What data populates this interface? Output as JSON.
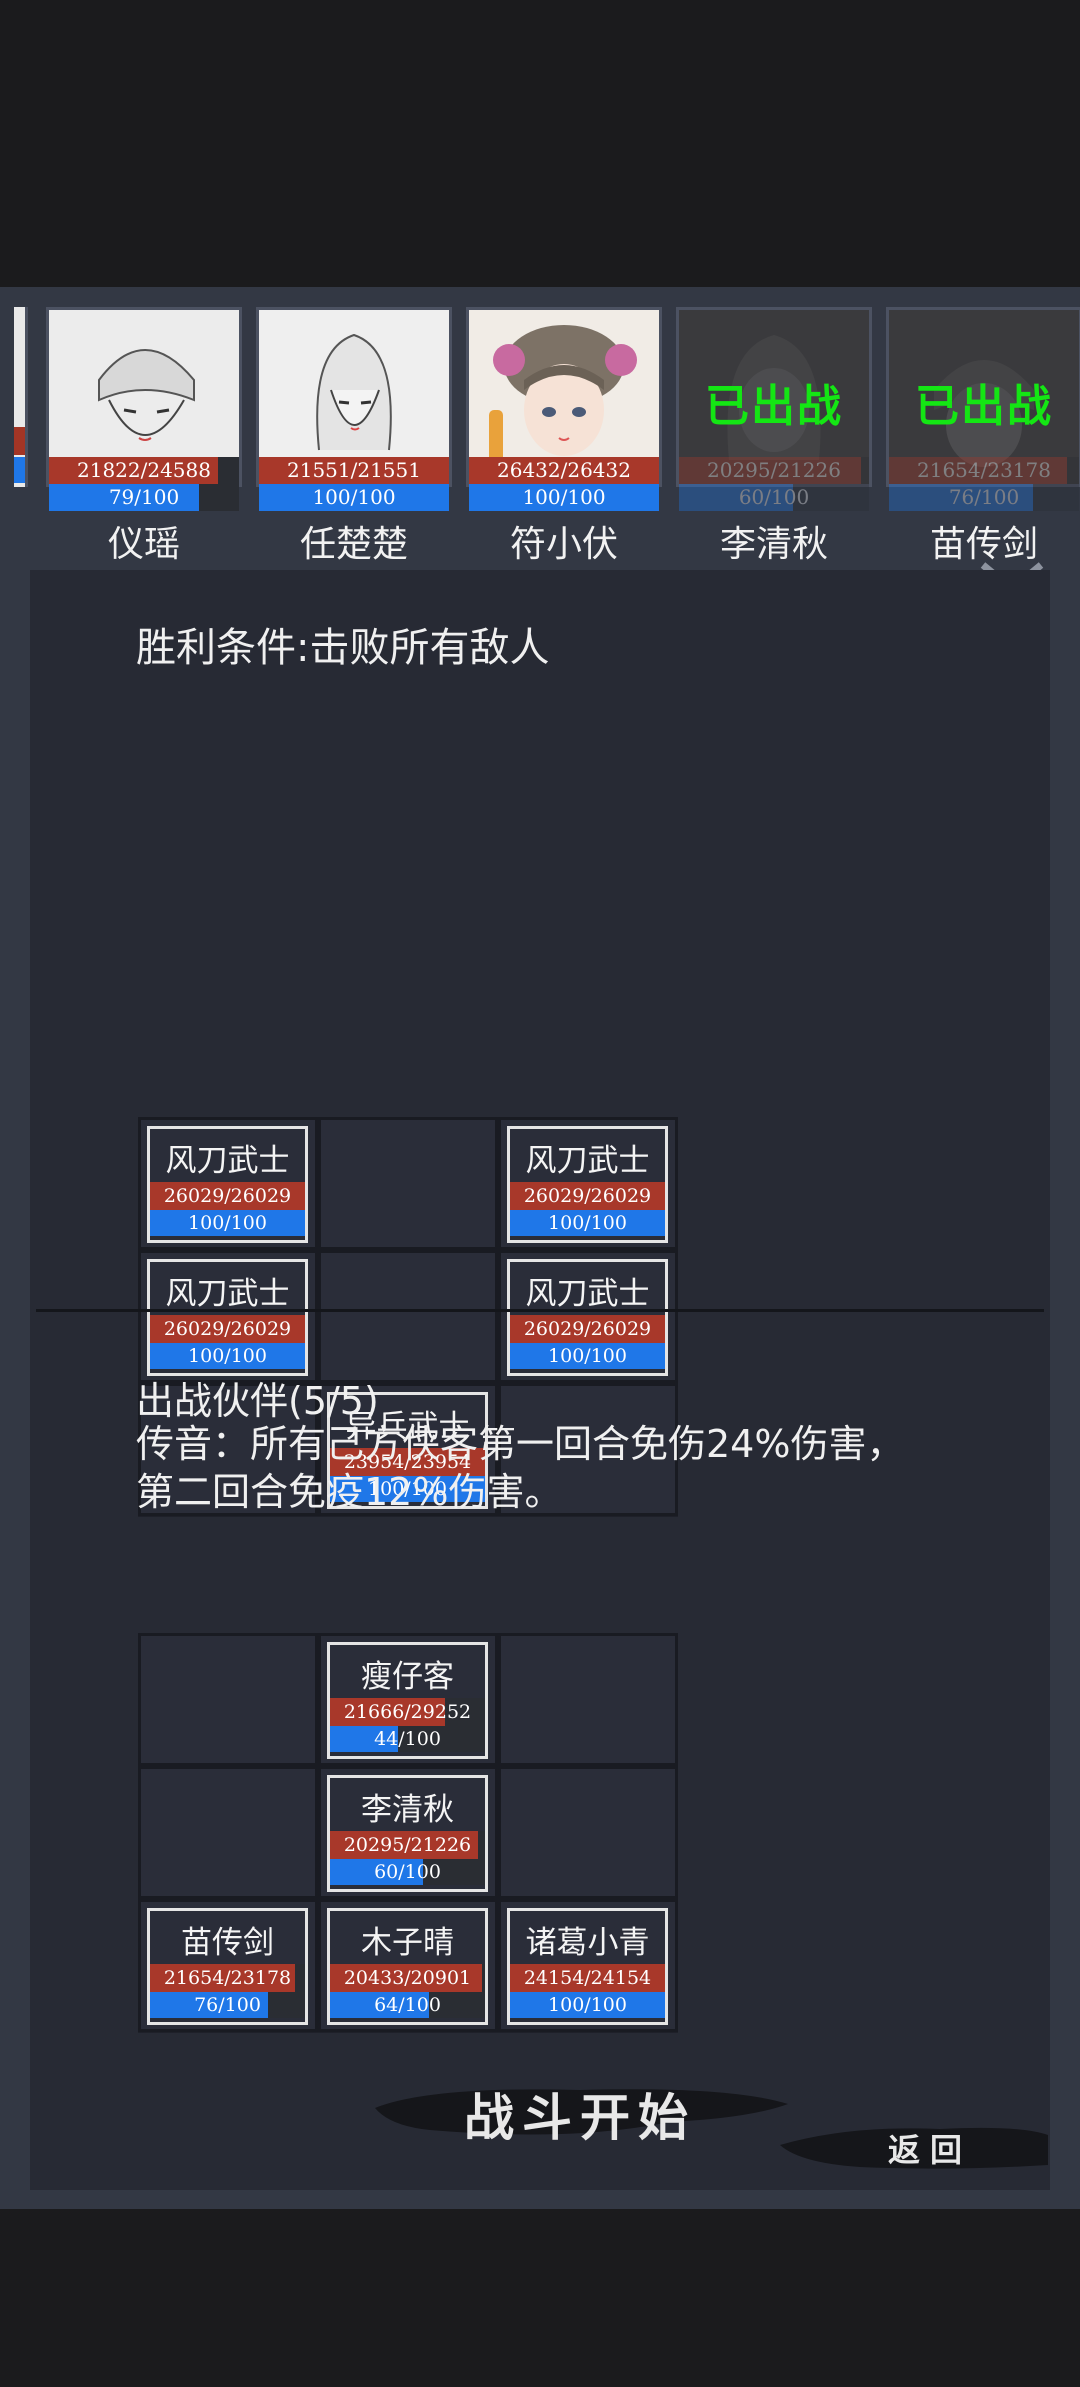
{
  "roster": [
    {
      "name": "仪瑶",
      "hp_text": "21822/24588",
      "hp": 21822,
      "hp_max": 24588,
      "mp_text": "79/100",
      "mp": 79,
      "deployed": false,
      "deployed_label": ""
    },
    {
      "name": "任楚楚",
      "hp_text": "21551/21551",
      "hp": 21551,
      "hp_max": 21551,
      "mp_text": "100/100",
      "mp": 100,
      "deployed": false,
      "deployed_label": ""
    },
    {
      "name": "符小伏",
      "hp_text": "26432/26432",
      "hp": 26432,
      "hp_max": 26432,
      "mp_text": "100/100",
      "mp": 100,
      "deployed": false,
      "deployed_label": ""
    },
    {
      "name": "李清秋",
      "hp_text": "20295/21226",
      "hp": 20295,
      "hp_max": 21226,
      "mp_text": "60/100",
      "mp": 60,
      "deployed": true,
      "deployed_label": "已出战"
    },
    {
      "name": "苗传剑",
      "hp_text": "21654/23178",
      "hp": 21654,
      "hp_max": 23178,
      "mp_text": "76/100",
      "mp": 76,
      "deployed": true,
      "deployed_label": "已出战"
    }
  ],
  "victory_condition": "胜利条件:击败所有敌人",
  "enemies": [
    {
      "name": "风刀武士",
      "hp_text": "26029/26029",
      "hp": 26029,
      "hp_max": 26029,
      "mp_text": "100/100",
      "mp": 100
    },
    {
      "name": "风刀武士",
      "hp_text": "26029/26029",
      "hp": 26029,
      "hp_max": 26029,
      "mp_text": "100/100",
      "mp": 100
    },
    {
      "name": "风刀武士",
      "hp_text": "26029/26029",
      "hp": 26029,
      "hp_max": 26029,
      "mp_text": "100/100",
      "mp": 100
    },
    {
      "name": "风刀武士",
      "hp_text": "26029/26029",
      "hp": 26029,
      "hp_max": 26029,
      "mp_text": "100/100",
      "mp": 100
    },
    {
      "name": "异兵武士",
      "hp_text": "23954/23954",
      "hp": 23954,
      "hp_max": 23954,
      "mp_text": "100/100",
      "mp": 100
    }
  ],
  "partners_title": "出战伙伴(5/5)",
  "buff_text": "传音：所有己方侠客第一回合免伤24%伤害，第二回合免疫12%伤害。",
  "partners": [
    {
      "name": "瘦仔客",
      "hp_text": "21666/29252",
      "hp": 21666,
      "hp_max": 29252,
      "mp_text": "44/100",
      "mp": 44
    },
    {
      "name": "李清秋",
      "hp_text": "20295/21226",
      "hp": 20295,
      "hp_max": 21226,
      "mp_text": "60/100",
      "mp": 60
    },
    {
      "name": "苗传剑",
      "hp_text": "21654/23178",
      "hp": 21654,
      "hp_max": 23178,
      "mp_text": "76/100",
      "mp": 76
    },
    {
      "name": "木子晴",
      "hp_text": "20433/20901",
      "hp": 20433,
      "hp_max": 20901,
      "mp_text": "64/100",
      "mp": 64
    },
    {
      "name": "诸葛小青",
      "hp_text": "24154/24154",
      "hp": 24154,
      "hp_max": 24154,
      "mp_text": "100/100",
      "mp": 100
    }
  ],
  "buttons": {
    "start": "战斗开始",
    "back": "返回"
  },
  "colors": {
    "hp": "#a8382a",
    "mp": "#1f77e8",
    "deployed": "#14e614",
    "panel": "#272a34"
  }
}
